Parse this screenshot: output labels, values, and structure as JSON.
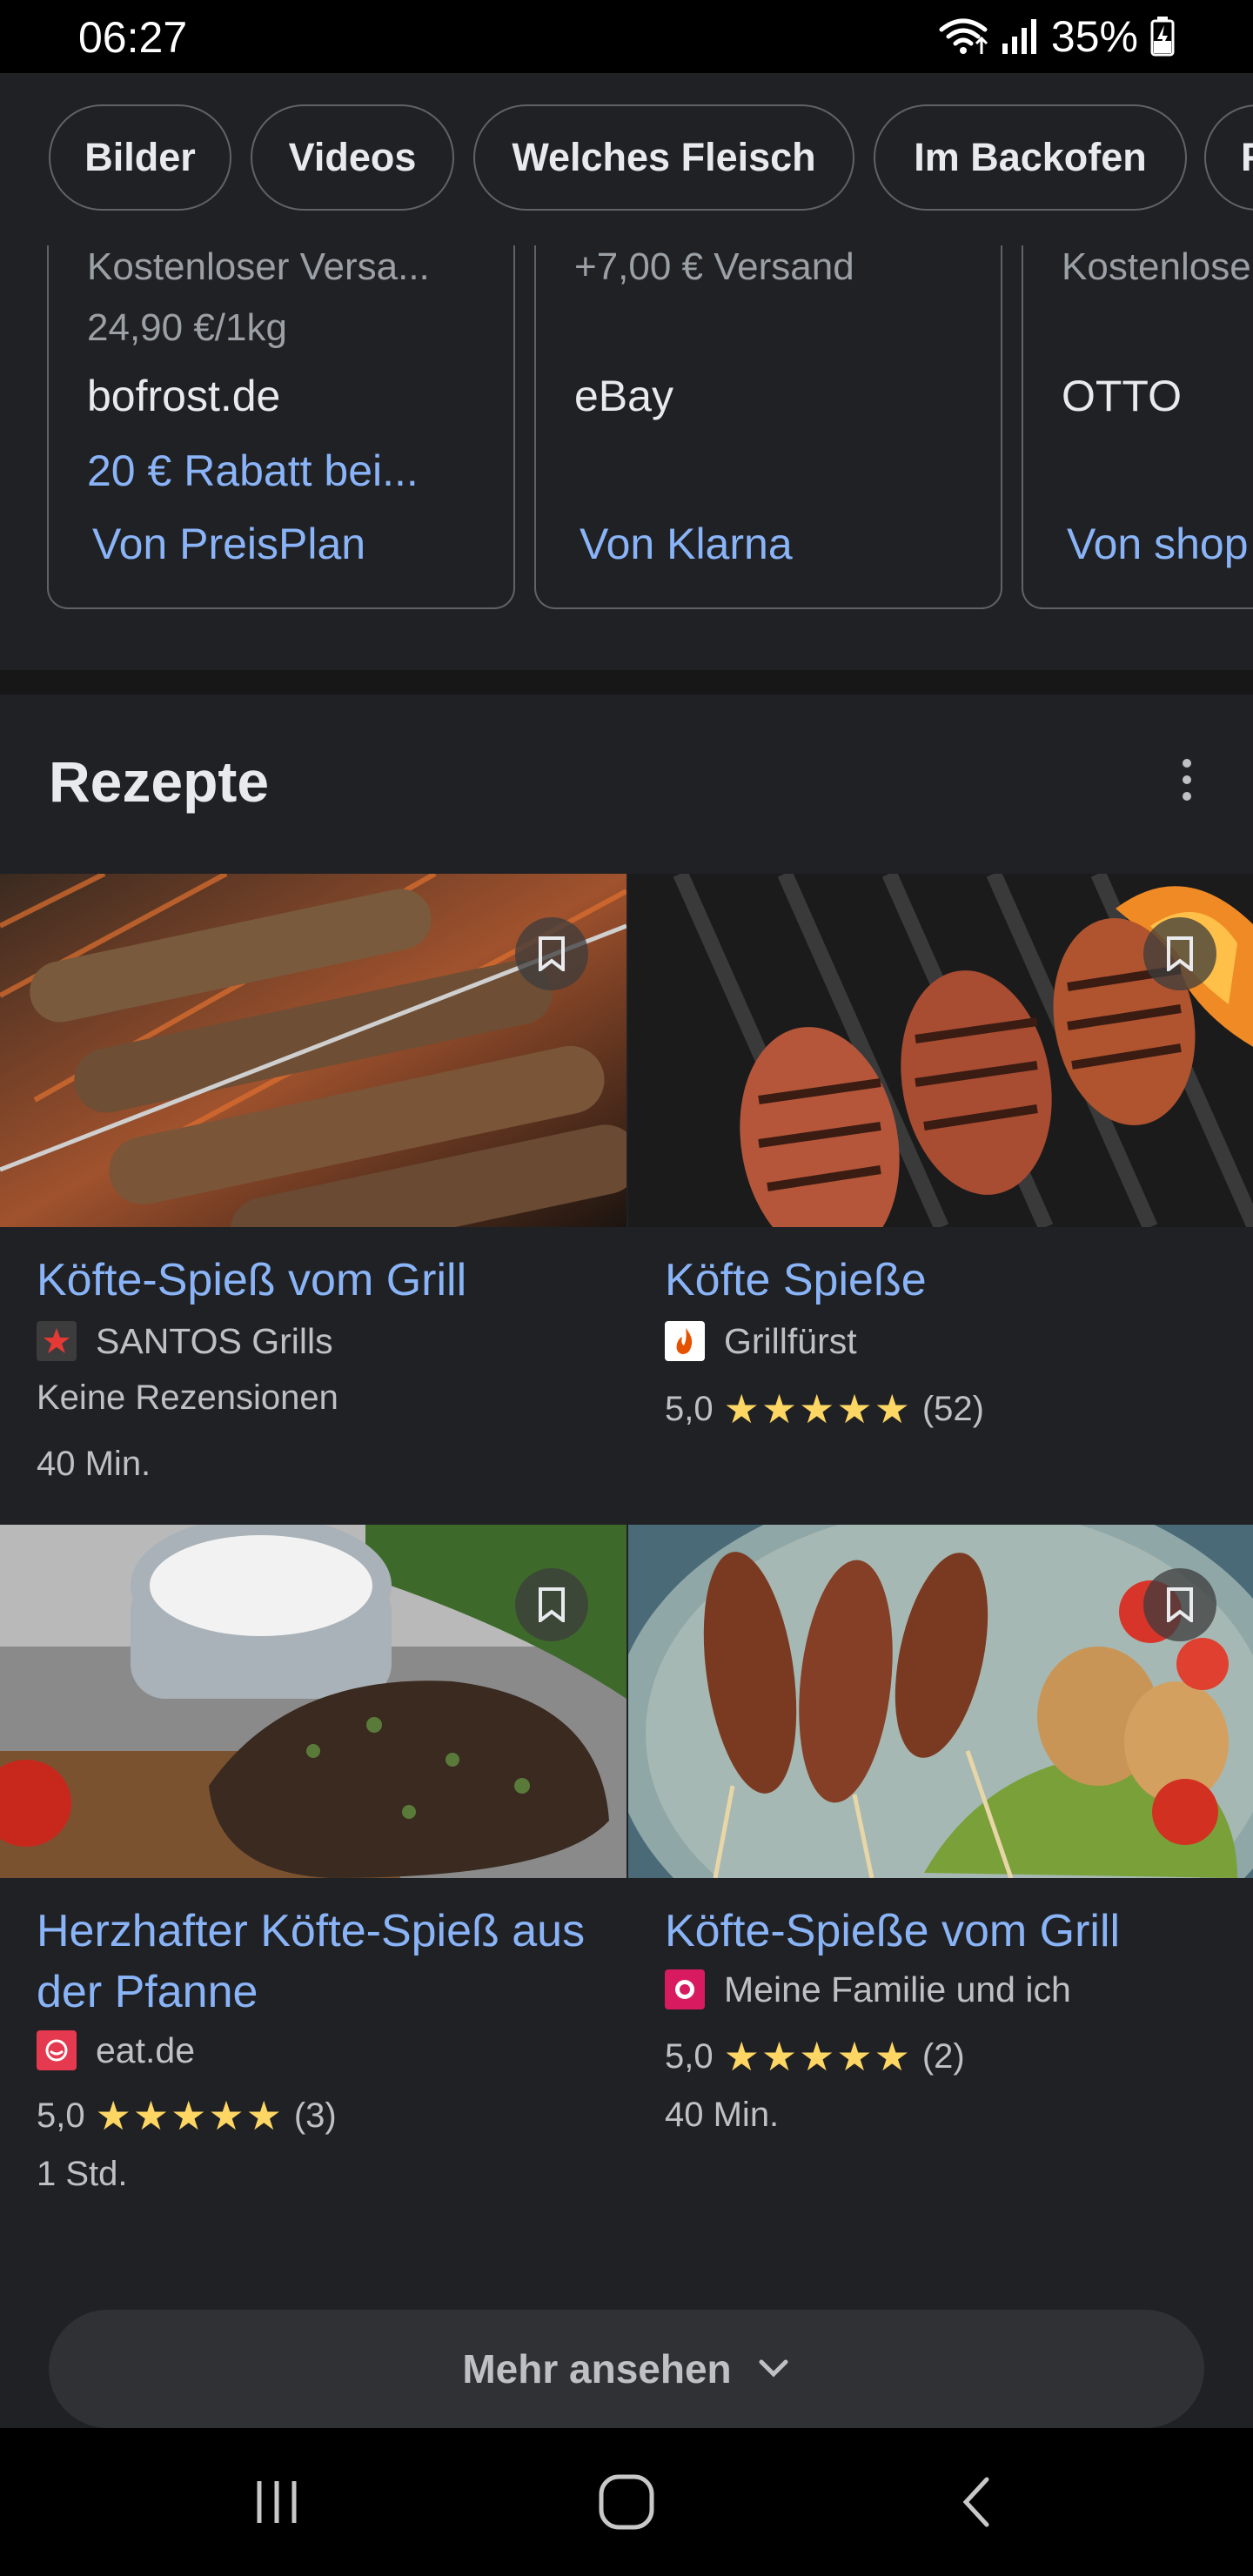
{
  "status_bar": {
    "time": "06:27",
    "battery": "35%"
  },
  "chips": [
    "Bilder",
    "Videos",
    "Welches Fleisch",
    "Im Backofen",
    "F"
  ],
  "shopping": [
    {
      "shipping": "Kostenloser Versa...",
      "unit_price": "24,90 €/1kg",
      "store": "bofrost.de",
      "promo": "20 € Rabatt bei...",
      "from": "Von PreisPlan"
    },
    {
      "shipping": "+7,00 € Versand",
      "unit_price": "",
      "store": "eBay",
      "promo": "",
      "from": "Von Klarna"
    },
    {
      "shipping": "Kostenlose",
      "unit_price": "",
      "store": "OTTO",
      "promo": "",
      "from": "Von shop"
    }
  ],
  "recipes_section": {
    "title": "Rezepte",
    "items": [
      {
        "title": "Köfte-Spieß vom Grill",
        "source": "SANTOS Grills",
        "rating": "",
        "stars": "",
        "count": "",
        "reviews_text": "Keine Rezensionen",
        "time": "40 Min.",
        "favicon_color": "#e53935"
      },
      {
        "title": "Köfte Spieße",
        "source": "Grillfürst",
        "rating": "5,0",
        "stars": "★★★★★",
        "count": "(52)",
        "reviews_text": "",
        "time": "",
        "favicon_color": "#e65100"
      },
      {
        "title": "Herzhafter Köfte-Spieß aus der Pfanne",
        "source": "eat.de",
        "rating": "5,0",
        "stars": "★★★★★",
        "count": "(3)",
        "reviews_text": "",
        "time": "1 Std.",
        "favicon_color": "#e53950"
      },
      {
        "title": "Köfte-Spieße vom Grill",
        "source": "Meine Familie und ich",
        "rating": "5,0",
        "stars": "★★★★★",
        "count": "(2)",
        "reviews_text": "",
        "time": "40 Min.",
        "favicon_color": "#d81b60"
      }
    ]
  },
  "more_button": {
    "label": "Mehr ansehen"
  },
  "colors": {
    "background": "#202124",
    "link": "#8ab4f8",
    "star": "#fdd663",
    "text_secondary": "#bdc1c6"
  }
}
